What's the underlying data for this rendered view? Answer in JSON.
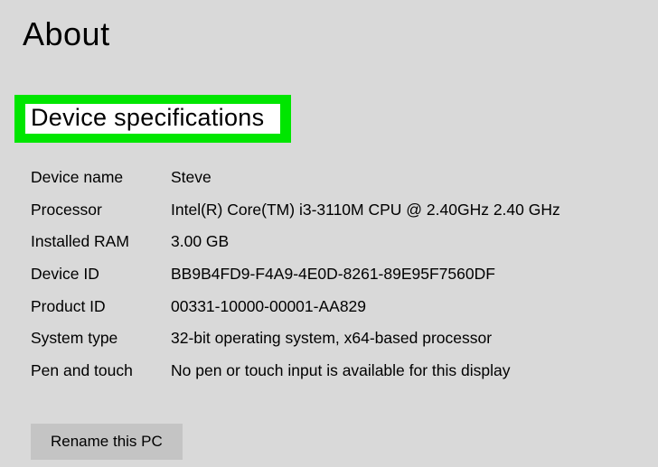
{
  "page": {
    "title": "About"
  },
  "section": {
    "header": "Device specifications"
  },
  "specs": {
    "device_name": {
      "label": "Device name",
      "value": "Steve"
    },
    "processor": {
      "label": "Processor",
      "value": "Intel(R) Core(TM) i3-3110M CPU @ 2.40GHz   2.40 GHz"
    },
    "installed_ram": {
      "label": "Installed RAM",
      "value": "3.00 GB"
    },
    "device_id": {
      "label": "Device ID",
      "value": "BB9B4FD9-F4A9-4E0D-8261-89E95F7560DF"
    },
    "product_id": {
      "label": "Product ID",
      "value": "00331-10000-00001-AA829"
    },
    "system_type": {
      "label": "System type",
      "value": "32-bit operating system, x64-based processor"
    },
    "pen_and_touch": {
      "label": "Pen and touch",
      "value": "No pen or touch input is available for this display"
    }
  },
  "buttons": {
    "rename": "Rename this PC"
  }
}
